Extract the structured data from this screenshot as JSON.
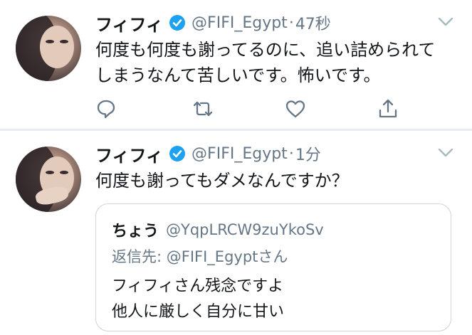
{
  "tweets": [
    {
      "author": {
        "name": "フィフィ",
        "handle": "@FIFI_Egypt",
        "verified": true
      },
      "separator": "·",
      "time": "47秒",
      "text_lines": [
        "何度も何度も謝ってるのに、追い詰められて",
        "しまうなんて苦しいです。怖いです。"
      ],
      "actions": [
        "reply-icon",
        "retweet-icon",
        "like-icon",
        "share-icon"
      ]
    },
    {
      "author": {
        "name": "フィフィ",
        "handle": "@FIFI_Egypt",
        "verified": true
      },
      "separator": "·",
      "time": "1分",
      "text_lines": [
        "何度も謝ってもダメなんですか？"
      ],
      "quote": {
        "name": "ちょう",
        "handle": "@YqpLRCW9zuYkoSv",
        "reply_prefix": "返信先: ",
        "reply_to": "@FIFI_Egypt",
        "reply_suffix": "さん",
        "text_lines": [
          "フィフィさん残念ですよ",
          "他人に厳しく自分に甘い"
        ]
      }
    }
  ],
  "colors": {
    "text": "#14171a",
    "secondary": "#657786",
    "verified": "#1da1f2",
    "border": "#ccd6dd",
    "divider": "#e6ecf0"
  }
}
